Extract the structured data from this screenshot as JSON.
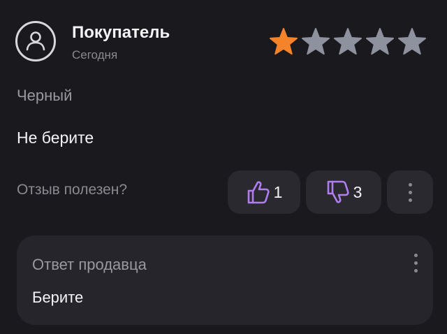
{
  "review": {
    "author": "Покупатель",
    "date": "Сегодня",
    "rating": 1,
    "max_rating": 5,
    "variant": "Черный",
    "text": "Не берите"
  },
  "helpful": {
    "label": "Отзыв полезен?",
    "likes": "1",
    "dislikes": "3"
  },
  "seller_reply": {
    "title": "Ответ продавца",
    "text": "Берите"
  },
  "colors": {
    "background": "#1a191e",
    "star_active": "#f5832a",
    "star_inactive": "#8e919e",
    "vote_icon": "#b07ef0"
  },
  "icons": {
    "avatar": "user-circle-icon",
    "like": "thumbs-up-icon",
    "dislike": "thumbs-down-icon",
    "more": "more-vertical-icon"
  }
}
